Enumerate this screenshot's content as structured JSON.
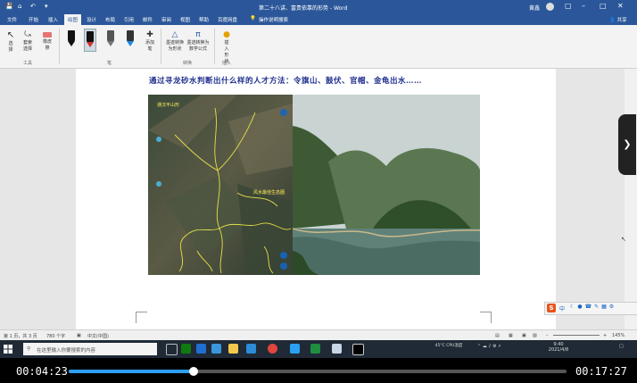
{
  "titlebar": {
    "doc_title": "第二十八讲、富贵依靠的形势 - Word",
    "user": "黄鑫"
  },
  "ribbon_tabs": [
    "文件",
    "开始",
    "插入",
    "绘图",
    "设计",
    "布局",
    "引用",
    "邮件",
    "审阅",
    "视图",
    "帮助",
    "百度网盘",
    "操作说明搜索"
  ],
  "share_label": "共享",
  "ribbon": {
    "tools": {
      "select": "选择",
      "lasso": "套索选择",
      "eraser": "橡皮擦",
      "add_pen": "添加笔",
      "ink_to_shape": "墨迹转换为形状",
      "ink_to_math": "墨迹转换为数学公式",
      "insert_shape": "插入形状"
    },
    "groups": {
      "tools": "工具",
      "pens": "笔",
      "convert": "转换",
      "insert": "插入"
    }
  },
  "document": {
    "heading": "通过寻龙砂水判断出什么样的人才方法：令旗山、鼓伏、官帽、金龟出水……",
    "map_labels": {
      "top": "通汉平山形",
      "right": "风水最佳生态圈"
    }
  },
  "statusbar": {
    "page": "第 1 页，共 3 页",
    "words": "780 个字",
    "lang": "中文(中国)",
    "zoom": "145%"
  },
  "ime": {
    "logo": "S",
    "mode": "中"
  },
  "taskbar": {
    "search_placeholder": "在这里输入你要搜索的内容",
    "weather": "45°C CPU温度",
    "clock_time": "9:40",
    "clock_date": "2021/4/8"
  },
  "player": {
    "current": "00:04:23",
    "total": "00:17:27",
    "progress": 0.251
  },
  "colors": {
    "word_blue": "#2b579a",
    "heading": "#1f2f8f",
    "progress": "#2e9ef4",
    "map_line": "#e6e04a"
  }
}
